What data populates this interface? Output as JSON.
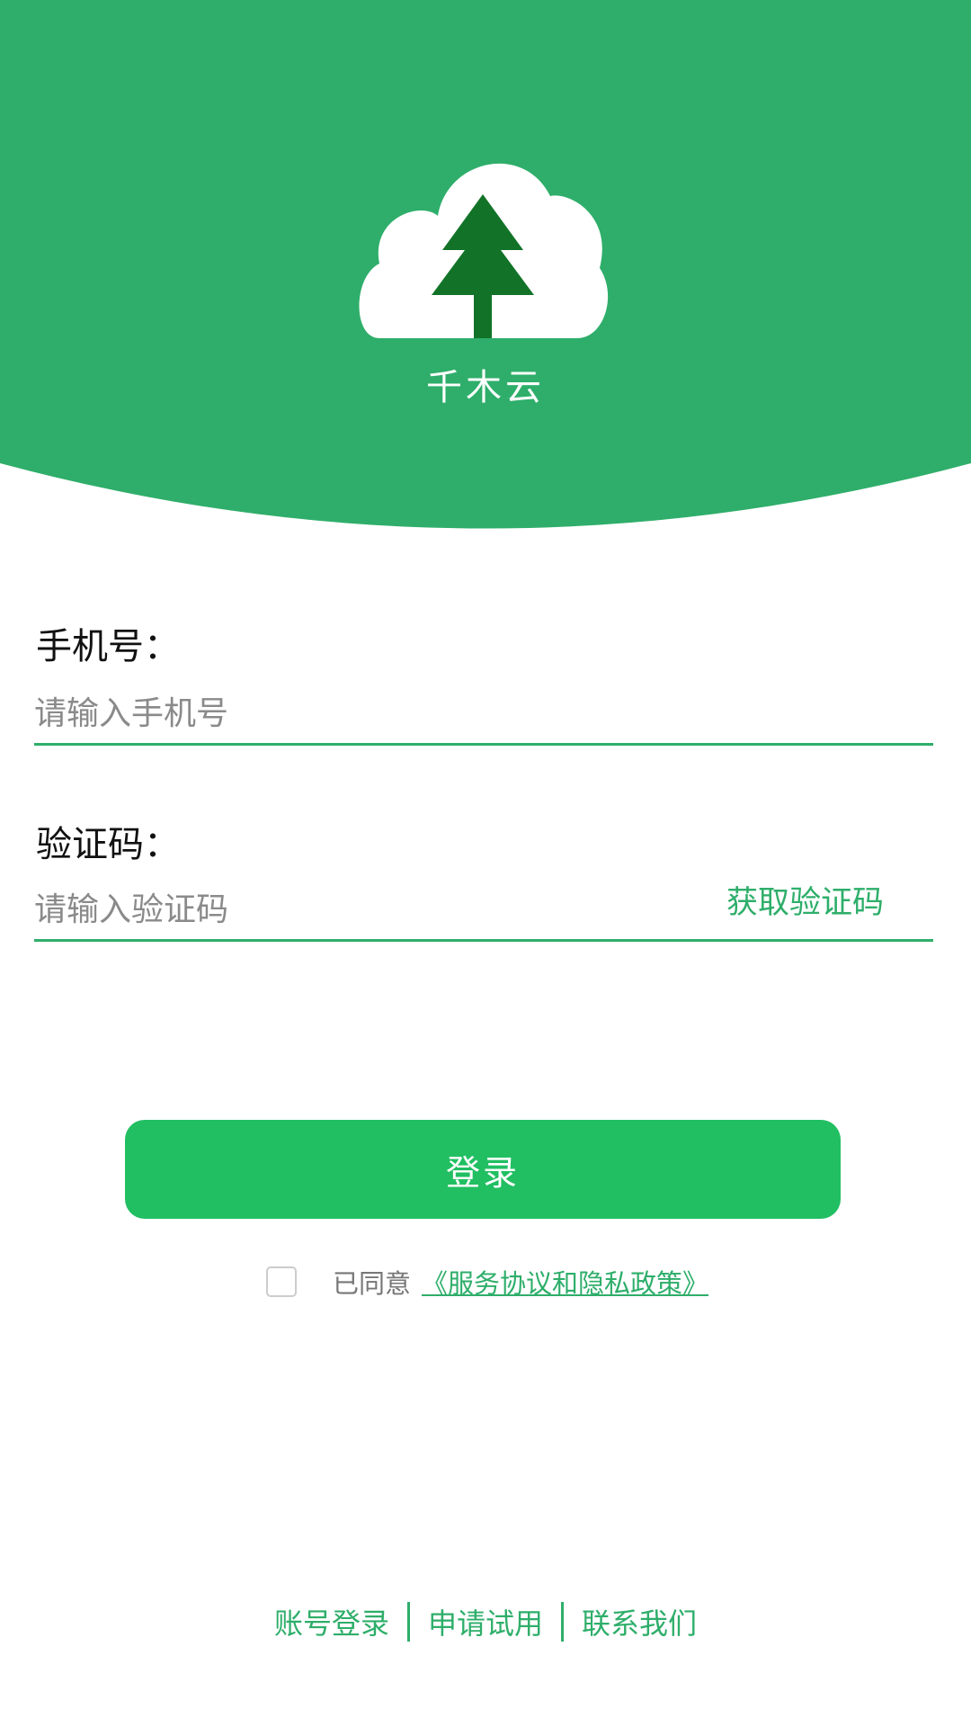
{
  "colors": {
    "brand_green": "#2eae6a",
    "button_green": "#21bf62",
    "logo_tree": "#127328"
  },
  "header": {
    "logo_icon": "tree-cloud-logo",
    "app_name": "千木云"
  },
  "form": {
    "phone": {
      "label": "手机号：",
      "placeholder": "请输入手机号",
      "value": ""
    },
    "code": {
      "label": "验证码：",
      "placeholder": "请输入验证码",
      "value": "",
      "get_code_label": "获取验证码"
    },
    "login_label": "登录",
    "agreement": {
      "checked": false,
      "text": "已同意",
      "link": "《服务协议和隐私政策》"
    }
  },
  "footer": {
    "links": [
      "账号登录",
      "申请试用",
      "联系我们"
    ]
  }
}
